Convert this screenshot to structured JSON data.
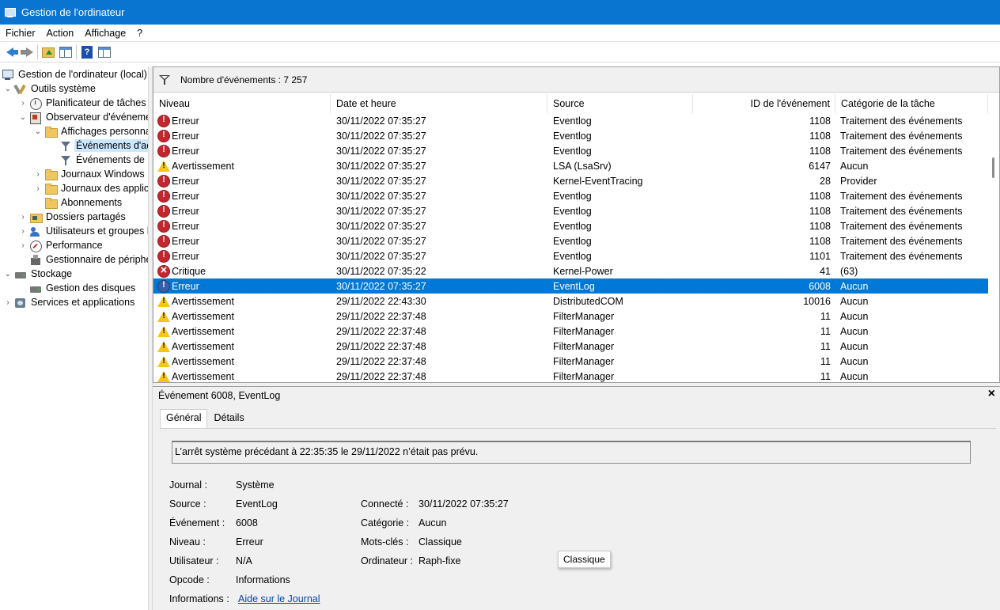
{
  "window": {
    "title": "Gestion de l'ordinateur",
    "icon": "computer-management-icon"
  },
  "menu": [
    "Fichier",
    "Action",
    "Affichage",
    "?"
  ],
  "toolbar": {
    "buttons": [
      "back-icon",
      "forward-icon",
      "up-folder-icon",
      "show-hide-console-tree-icon",
      "help-icon",
      "action-pane-icon"
    ]
  },
  "tree": [
    {
      "label": "Gestion de l'ordinateur (local)",
      "icon": "computer-icon",
      "chev": "",
      "selected": false
    },
    {
      "label": "Outils système",
      "icon": "tools-icon",
      "chev": "v",
      "selected": false
    },
    {
      "label": "Planificateur de tâches",
      "icon": "clock-icon",
      "chev": ">",
      "selected": false
    },
    {
      "label": "Observateur d'événeme",
      "icon": "event-viewer-icon",
      "chev": "v",
      "selected": false
    },
    {
      "label": "Affichages personna",
      "icon": "folder-icon",
      "chev": "v",
      "selected": false
    },
    {
      "label": "Événements d'ac",
      "icon": "filter-icon",
      "chev": "",
      "selected": true
    },
    {
      "label": "Événements de l",
      "icon": "filter-icon",
      "chev": "",
      "selected": false
    },
    {
      "label": "Journaux Windows",
      "icon": "folder-icon",
      "chev": ">",
      "selected": false
    },
    {
      "label": "Journaux des applic",
      "icon": "folder-icon",
      "chev": ">",
      "selected": false
    },
    {
      "label": "Abonnements",
      "icon": "folder-icon",
      "chev": "",
      "selected": false
    },
    {
      "label": "Dossiers partagés",
      "icon": "shared-folder-icon",
      "chev": ">",
      "selected": false
    },
    {
      "label": "Utilisateurs et groupes l",
      "icon": "users-icon",
      "chev": ">",
      "selected": false
    },
    {
      "label": "Performance",
      "icon": "performance-icon",
      "chev": ">",
      "selected": false
    },
    {
      "label": "Gestionnaire de périphé",
      "icon": "device-manager-icon",
      "chev": "",
      "selected": false
    },
    {
      "label": "Stockage",
      "icon": "storage-icon",
      "chev": "v",
      "selected": false
    },
    {
      "label": "Gestion des disques",
      "icon": "disk-icon",
      "chev": "",
      "selected": false
    },
    {
      "label": "Services et applications",
      "icon": "services-icon",
      "chev": ">",
      "selected": false
    }
  ],
  "events": {
    "count_label": "Nombre d'événements : 7 257",
    "columns": [
      "Niveau",
      "Date et heure",
      "Source",
      "ID de l'événement",
      "Catégorie de la tâche"
    ],
    "rows": [
      {
        "level": "Erreur",
        "type": "error",
        "date": "30/11/2022 07:35:27",
        "source": "Eventlog",
        "id": "1108",
        "category": "Traitement des événements",
        "selected": false
      },
      {
        "level": "Erreur",
        "type": "error",
        "date": "30/11/2022 07:35:27",
        "source": "Eventlog",
        "id": "1108",
        "category": "Traitement des événements",
        "selected": false
      },
      {
        "level": "Erreur",
        "type": "error",
        "date": "30/11/2022 07:35:27",
        "source": "Eventlog",
        "id": "1108",
        "category": "Traitement des événements",
        "selected": false
      },
      {
        "level": "Avertissement",
        "type": "warning",
        "date": "30/11/2022 07:35:27",
        "source": "LSA (LsaSrv)",
        "id": "6147",
        "category": "Aucun",
        "selected": false
      },
      {
        "level": "Erreur",
        "type": "error",
        "date": "30/11/2022 07:35:27",
        "source": "Kernel-EventTracing",
        "id": "28",
        "category": "Provider",
        "selected": false
      },
      {
        "level": "Erreur",
        "type": "error",
        "date": "30/11/2022 07:35:27",
        "source": "Eventlog",
        "id": "1108",
        "category": "Traitement des événements",
        "selected": false
      },
      {
        "level": "Erreur",
        "type": "error",
        "date": "30/11/2022 07:35:27",
        "source": "Eventlog",
        "id": "1108",
        "category": "Traitement des événements",
        "selected": false
      },
      {
        "level": "Erreur",
        "type": "error",
        "date": "30/11/2022 07:35:27",
        "source": "Eventlog",
        "id": "1108",
        "category": "Traitement des événements",
        "selected": false
      },
      {
        "level": "Erreur",
        "type": "error",
        "date": "30/11/2022 07:35:27",
        "source": "Eventlog",
        "id": "1108",
        "category": "Traitement des événements",
        "selected": false
      },
      {
        "level": "Erreur",
        "type": "error",
        "date": "30/11/2022 07:35:27",
        "source": "Eventlog",
        "id": "1101",
        "category": "Traitement des événements",
        "selected": false
      },
      {
        "level": "Critique",
        "type": "critical",
        "date": "30/11/2022 07:35:22",
        "source": "Kernel-Power",
        "id": "41",
        "category": "(63)",
        "selected": false
      },
      {
        "level": "Erreur",
        "type": "error",
        "date": "30/11/2022 07:35:27",
        "source": "EventLog",
        "id": "6008",
        "category": "Aucun",
        "selected": true
      },
      {
        "level": "Avertissement",
        "type": "warning",
        "date": "29/11/2022 22:43:30",
        "source": "DistributedCOM",
        "id": "10016",
        "category": "Aucun",
        "selected": false
      },
      {
        "level": "Avertissement",
        "type": "warning",
        "date": "29/11/2022 22:37:48",
        "source": "FilterManager",
        "id": "11",
        "category": "Aucun",
        "selected": false
      },
      {
        "level": "Avertissement",
        "type": "warning",
        "date": "29/11/2022 22:37:48",
        "source": "FilterManager",
        "id": "11",
        "category": "Aucun",
        "selected": false
      },
      {
        "level": "Avertissement",
        "type": "warning",
        "date": "29/11/2022 22:37:48",
        "source": "FilterManager",
        "id": "11",
        "category": "Aucun",
        "selected": false
      },
      {
        "level": "Avertissement",
        "type": "warning",
        "date": "29/11/2022 22:37:48",
        "source": "FilterManager",
        "id": "11",
        "category": "Aucun",
        "selected": false
      },
      {
        "level": "Avertissement",
        "type": "warning",
        "date": "29/11/2022 22:37:48",
        "source": "FilterManager",
        "id": "11",
        "category": "Aucun",
        "selected": false
      }
    ]
  },
  "detail": {
    "title": "Événement 6008, EventLog",
    "close": "×",
    "tabs": [
      "Général",
      "Détails"
    ],
    "message": "L’arrêt système précédant à 22:35:35 le 29/11/2022 n’était pas prévu.",
    "fields": {
      "journal_label": "Journal :",
      "journal": "Système",
      "source_label": "Source :",
      "source": "EventLog",
      "event_label": "Événement :",
      "event": "6008",
      "level_label": "Niveau :",
      "level": "Erreur",
      "user_label": "Utilisateur :",
      "user": "N/A",
      "opcode_label": "Opcode :",
      "opcode": "Informations",
      "info_label": "Informations :",
      "info_link": "Aide sur le Journal",
      "logged_label": "Connecté :",
      "logged": "30/11/2022 07:35:27",
      "category_label": "Catégorie :",
      "category": "Aucun",
      "keywords_label": "Mots-clés :",
      "keywords": "Classique",
      "computer_label": "Ordinateur :",
      "computer": "Raph-fixe"
    },
    "tooltip": "Classique"
  }
}
